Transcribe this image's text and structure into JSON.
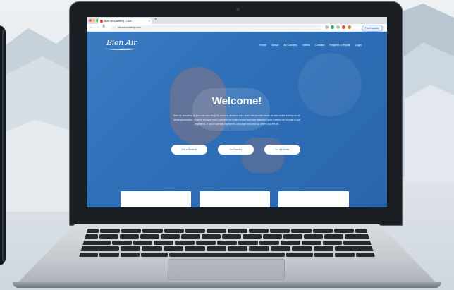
{
  "browser": {
    "tab_title": "Bien Air Academy - Lear...",
    "url": "bienairacademy.com",
    "update_button": "Finish update"
  },
  "site": {
    "logo_text": "Bien Air",
    "logo_subtext": "ACADEMY",
    "nav": [
      "Home",
      "About",
      "All Courses",
      "Videos",
      "Contact",
      "Request a Repair",
      "Login"
    ],
    "welcome_title": "Welcome!",
    "intro_text": "Bien Air Academy is your one-stop shop for learning all about your chair. We provide hands-on and online training for all dental procedures. If you're ready to learn, just click the button below that best describes your current role in order to get registered. If you're already registered, click login and pick up where you left off.",
    "cta_buttons": [
      "I'm a Student",
      "I'm Faculty",
      "I'm a Dentist"
    ]
  },
  "colors": {
    "hero_blue": "#2f6fb8",
    "button_text": "#2a66ad"
  }
}
